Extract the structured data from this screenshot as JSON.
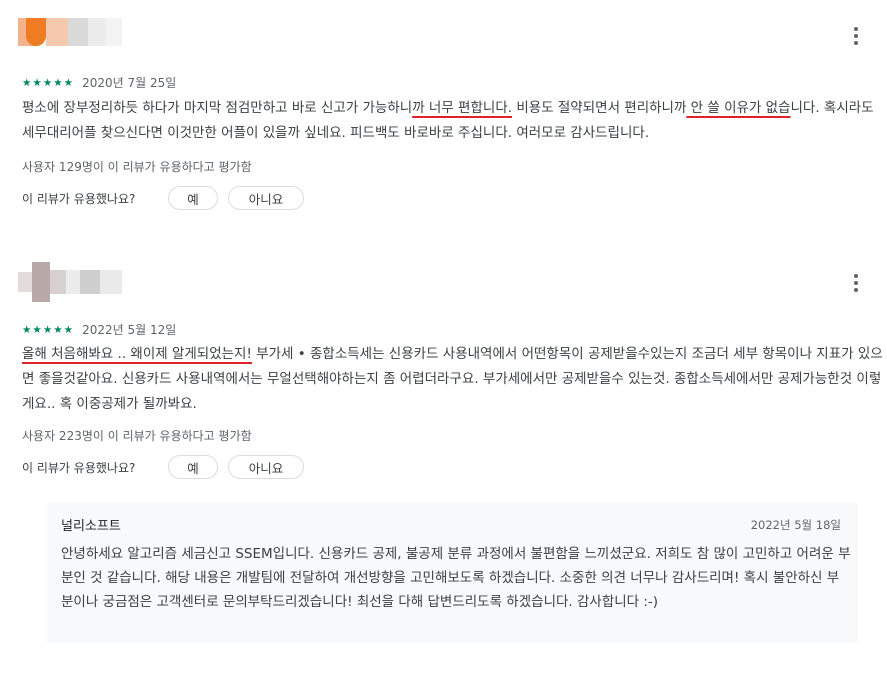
{
  "reviews": [
    {
      "rating_stars": "★★★★★",
      "date": "2020년 7월 25일",
      "body": {
        "part1": "평소에 장부정리하듯 하다가 마지막 점검만하고 바로 신고가 가능하니",
        "highlight1": "까 너무 편합니다.",
        "part2": " 비용도 절약되면서 편리하니까",
        "highlight2": " 안 쓸 이유가 없습",
        "part3": "니다. 혹시라도 세무대리어플 찾으신다면 이것만한 어플이 있을까 싶네요. 피드백도 바로바로 주십니다. 여러모로 감사드립니다."
      },
      "helpful_count": "사용자 129명이 이 리뷰가 유용하다고 평가함",
      "helpful_question": "이 리뷰가 유용했나요?",
      "yes_label": "예",
      "no_label": "아니요"
    },
    {
      "rating_stars": "★★★★★",
      "date": "2022년 5월 12일",
      "body": {
        "highlight1": "올해 처음해봐요 .. 왜이제 알게되었는지!",
        "part1": " 부가세 • 종합소득세는 신용카드 사용내역에서 어떤항목이 공제받을수있는지 조금더 세부 항목이나 지표가 있으면 좋을것같아요. 신용카드 사용내역에서는 무얼선택해야하는지 좀 어렵더라구요. 부가세에서만 공제받을수 있는것. 종합소득세에서만 공제가능한것 이렇게요.. 혹 이중공제가 될까봐요."
      },
      "helpful_count": "사용자 223명이 이 리뷰가 유용하다고 평가함",
      "helpful_question": "이 리뷰가 유용했나요?",
      "yes_label": "예",
      "no_label": "아니요"
    }
  ],
  "developer_reply": {
    "developer": "널리소프트",
    "date": "2022년 5월 18일",
    "text": "안녕하세요 알고리즘 세금신고 SSEM입니다. 신용카드 공제, 불공제 분류 과정에서 불편함을 느끼셨군요. 저희도 참 많이 고민하고 어려운 부분인 것 같습니다. 해당 내용은 개발팀에 전달하여 개선방향을 고민해보도록 하겠습니다. 소중한 의견 너무나 감사드리며! 혹시 불안하신 부분이나 궁금점은 고객센터로 문의부탁드리겠습니다! 최선을 다해 답변드리도록 하겠습니다. 감사합니다 :-)"
  },
  "colors": {
    "star": "#01875f",
    "highlight_underline": "#e0212a",
    "reply_bg": "#f8f9fa"
  },
  "icons": {
    "more": "more-vert-icon",
    "avatar": "blurred-avatar"
  }
}
